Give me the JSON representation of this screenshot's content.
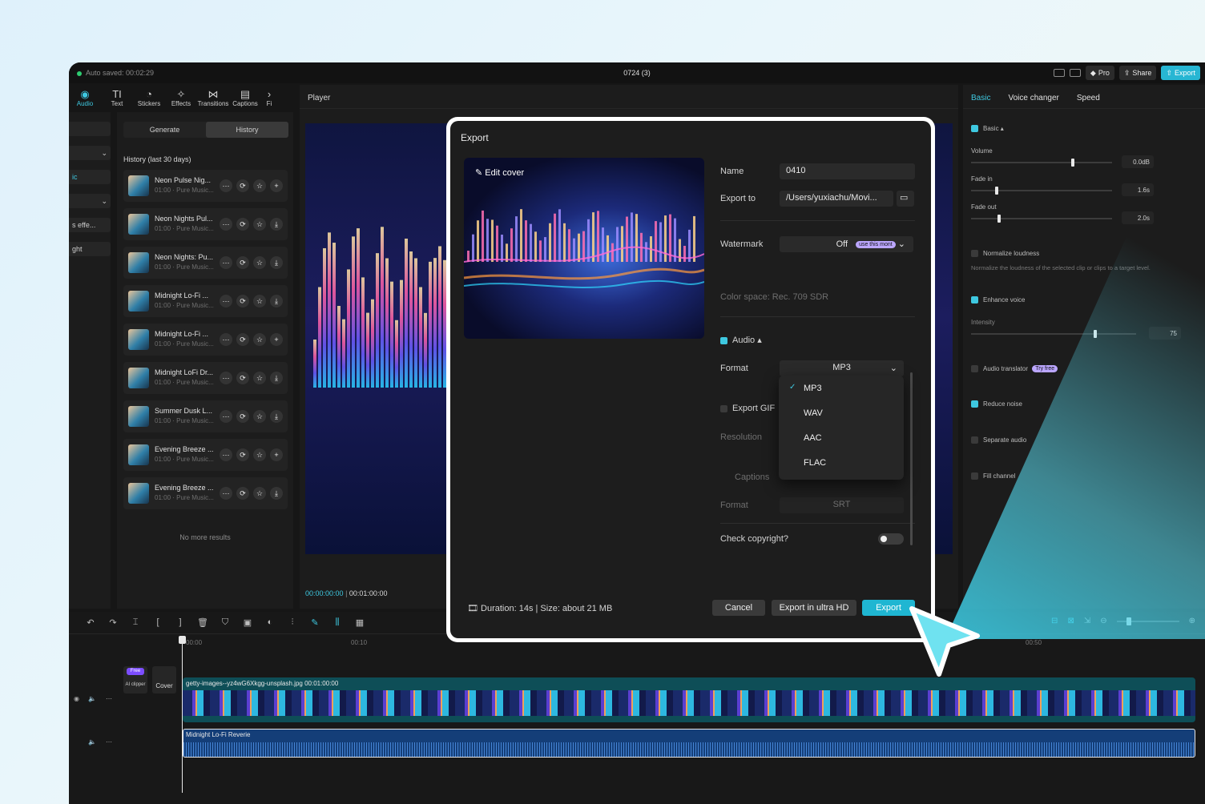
{
  "titlebar": {
    "autosave": "Auto saved: 00:02:29",
    "project": "0724 (3)",
    "pro_label": "Pro",
    "share_label": "Share",
    "export_label": "Export"
  },
  "toolbar": {
    "audio": "Audio",
    "text": "Text",
    "stickers": "Stickers",
    "effects": "Effects",
    "transitions": "Transitions",
    "captions": "Captions",
    "more": "Fi"
  },
  "leftstrip": {
    "items": [
      "ic",
      "s effe...",
      "ght"
    ]
  },
  "history": {
    "generate_tab": "Generate",
    "history_tab": "History",
    "title": "History (last 30 days)",
    "items": [
      {
        "name": "Neon Pulse Nig...",
        "sub": "01:00 · Pure Music..."
      },
      {
        "name": "Neon Nights Pul...",
        "sub": "01:00 · Pure Music..."
      },
      {
        "name": "Neon Nights: Pu...",
        "sub": "01:00 · Pure Music..."
      },
      {
        "name": "Midnight Lo-Fi ...",
        "sub": "01:00 · Pure Music..."
      },
      {
        "name": "Midnight Lo-Fi ...",
        "sub": "01:00 · Pure Music..."
      },
      {
        "name": "Midnight LoFi Dr...",
        "sub": "01:00 · Pure Music..."
      },
      {
        "name": "Summer Dusk L...",
        "sub": "01:00 · Pure Music..."
      },
      {
        "name": "Evening Breeze ...",
        "sub": "01:00 · Pure Music..."
      },
      {
        "name": "Evening Breeze ...",
        "sub": "01:00 · Pure Music..."
      }
    ],
    "no_more": "No more results"
  },
  "player": {
    "title": "Player",
    "current_time": "00:00:00:00",
    "total_time": "00:01:00:00"
  },
  "right": {
    "tabs": [
      "Basic",
      "Voice changer",
      "Speed"
    ],
    "basic_label": "Basic",
    "volume_label": "Volume",
    "volume_value": "0.0dB",
    "volume_level": 0.72,
    "fadein_label": "Fade in",
    "fadein_value": "1.6s",
    "fadein_level": 0.18,
    "fadeout_label": "Fade out",
    "fadeout_value": "2.0s",
    "fadeout_level": 0.2,
    "normalize_label": "Normalize loudness",
    "normalize_desc": "Normalize the loudness of the selected clip or clips to a target level.",
    "enhance_label": "Enhance voice",
    "intensity_label": "Intensity",
    "intensity_value": "75",
    "intensity_level": 0.75,
    "translator_label": "Audio translator",
    "translator_badge": "Try free",
    "reduce_label": "Reduce noise",
    "separate_label": "Separate audio",
    "fill_label": "Fill channel"
  },
  "timeline": {
    "ruler_marks": [
      "00:00",
      "00:10",
      "00:50"
    ],
    "video_clip": "getty-images--yz4wG6Xkgg-unsplash.jpg  00:01:00:00",
    "audio_clip": "Midnight Lo-Fi Reverie",
    "aiclip_badge": "Free",
    "aiclip_label": "AI clipper",
    "cover_label": "Cover"
  },
  "export_dialog": {
    "title": "Export",
    "edit_cover": "Edit cover",
    "name_label": "Name",
    "name_value": "0410",
    "export_to_label": "Export to",
    "export_to_value": "/Users/yuxiachu/Movi...",
    "watermark_label": "Watermark",
    "watermark_value": "Off",
    "watermark_badge": "use this mont",
    "color_space": "Color space: Rec. 709 SDR",
    "audio_label": "Audio",
    "format_label": "Format",
    "format_value": "MP3",
    "format_options": [
      "MP3",
      "WAV",
      "AAC",
      "FLAC"
    ],
    "gif_label": "Export GIF",
    "resolution_label": "Resolution",
    "captions_label": "Captions",
    "captions_format_label": "Format",
    "captions_format_value": "SRT",
    "copyright_label": "Check copyright?",
    "duration": "Duration: 14s | Size: about 21 MB",
    "cancel": "Cancel",
    "export_ultra": "Export in ultra HD",
    "export": "Export"
  },
  "colors": {
    "accent": "#3ec8e0",
    "export_button": "#1fb6d2"
  }
}
